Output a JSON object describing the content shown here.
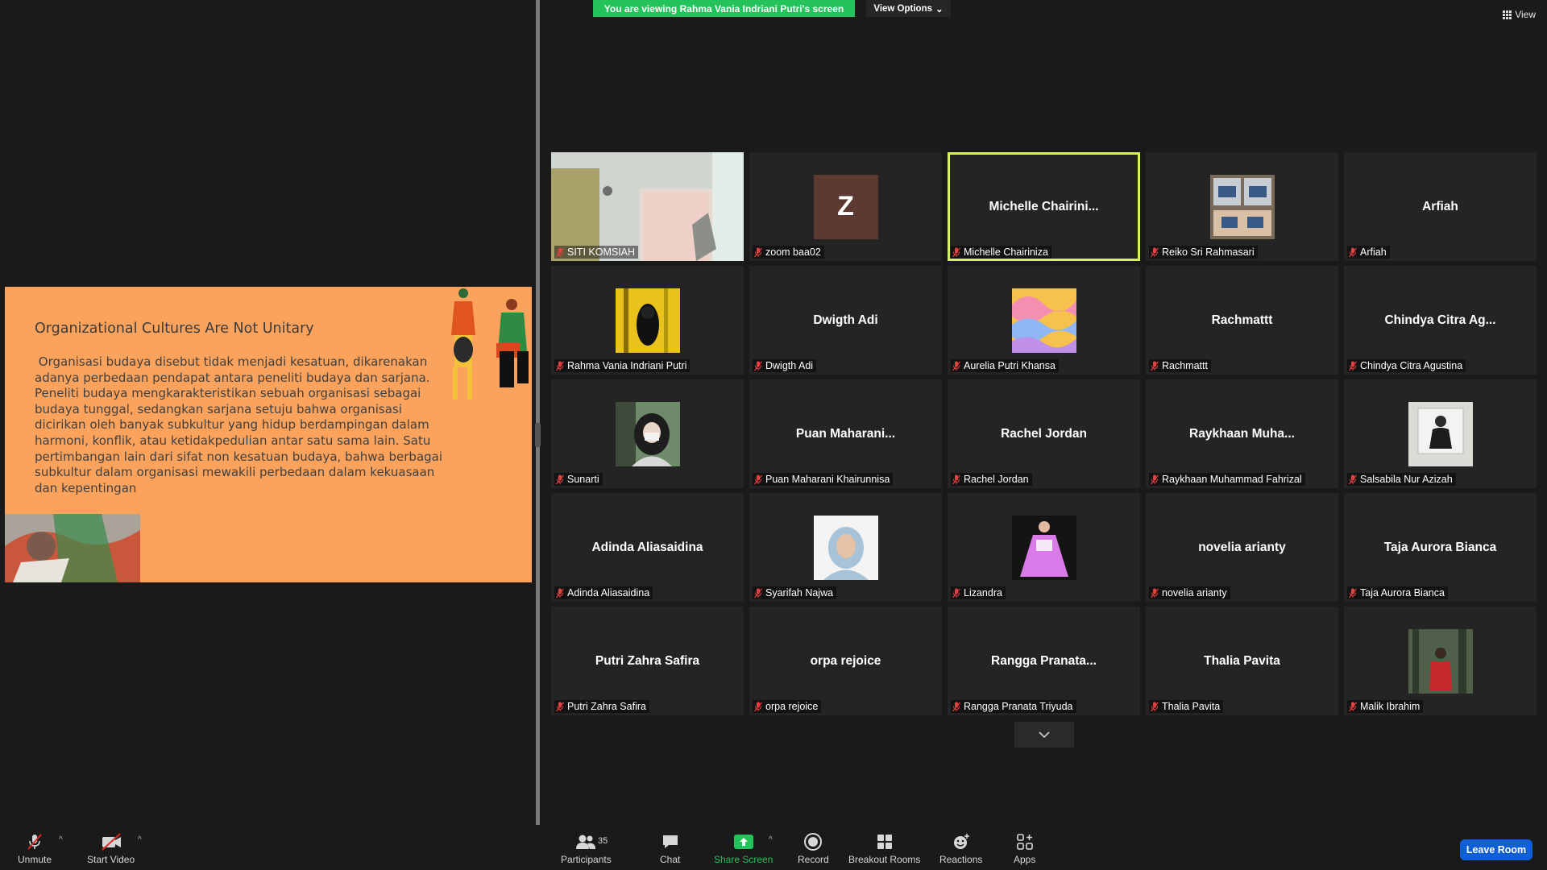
{
  "banner": {
    "viewing_text": "You are viewing Rahma Vania Indriani Putri's screen",
    "view_options_label": "View Options",
    "view_label": "View"
  },
  "slide": {
    "title": "Organizational Cultures Are Not Unitary",
    "body": " Organisasi budaya disebut tidak menjadi kesatuan, dikarenakan\nadanya perbedaan pendapat antara peneliti budaya dan sarjana.\nPeneliti budaya mengkarakteristikan sebuah organisasi sebagai\nbudaya tunggal, sedangkan sarjana setuju bahwa organisasi\ndicirikan oleh banyak subkultur yang hidup berdampingan dalam\nharmoni, konflik, atau ketidakpedulian antar satu sama lain. Satu\npertimbangan lain dari sifat non kesatuan budaya, bahwa berbagai\nsubkultur dalam organisasi mewakili perbedaan dalam kekuasaan\ndan kepentingan"
  },
  "participants": [
    {
      "label": "SITI KOMSIAH",
      "center": "",
      "kind": "video-room"
    },
    {
      "label": "zoom baa02",
      "center": "Z",
      "kind": "letter"
    },
    {
      "label": "Michelle Chairiniza",
      "center": "Michelle  Chairini...",
      "kind": "name",
      "active": true
    },
    {
      "label": "Reiko Sri Rahmasari",
      "center": "",
      "kind": "avatar-desk"
    },
    {
      "label": "Arfiah",
      "center": "Arfiah",
      "kind": "name"
    },
    {
      "label": "Rahma Vania Indriani Putri",
      "center": "",
      "kind": "avatar-yellow"
    },
    {
      "label": "Dwigth Adi",
      "center": "Dwigth Adi",
      "kind": "name"
    },
    {
      "label": "Aurelia Putri Khansa",
      "center": "",
      "kind": "avatar-waves"
    },
    {
      "label": "Rachmattt",
      "center": "Rachmattt",
      "kind": "name"
    },
    {
      "label": "Chindya Citra Agustina",
      "center": "Chindya Citra Ag...",
      "kind": "name"
    },
    {
      "label": "Sunarti",
      "center": "",
      "kind": "avatar-selfie"
    },
    {
      "label": "Puan Maharani Khairunnisa",
      "center": "Puan  Maharani...",
      "kind": "name"
    },
    {
      "label": "Rachel Jordan",
      "center": "Rachel Jordan",
      "kind": "name"
    },
    {
      "label": "Raykhaan Muhammad Fahrizal",
      "center": "Raykhaan  Muha...",
      "kind": "name"
    },
    {
      "label": "Salsabila Nur Azizah",
      "center": "",
      "kind": "avatar-polaroid"
    },
    {
      "label": "Adinda Aliasaidina",
      "center": "Adinda Aliasaidina",
      "kind": "name"
    },
    {
      "label": "Syarifah Najwa",
      "center": "",
      "kind": "avatar-hijab"
    },
    {
      "label": "Lizandra",
      "center": "",
      "kind": "avatar-dress"
    },
    {
      "label": "novelia arianty",
      "center": "novelia arianty",
      "kind": "name"
    },
    {
      "label": "Taja Aurora Bianca",
      "center": "Taja Aurora Bianca",
      "kind": "name"
    },
    {
      "label": "Putri Zahra Safira",
      "center": "Putri Zahra Safira",
      "kind": "name"
    },
    {
      "label": "orpa rejoice",
      "center": "orpa rejoice",
      "kind": "name"
    },
    {
      "label": "Rangga Pranata Triyuda",
      "center": "Rangga  Pranata...",
      "kind": "name"
    },
    {
      "label": "Thalia Pavita",
      "center": "Thalia Pavita",
      "kind": "name"
    },
    {
      "label": "Malik Ibrahim",
      "center": "",
      "kind": "avatar-forest"
    }
  ],
  "toolbar": {
    "unmute": "Unmute",
    "start_video": "Start Video",
    "participants": "Participants",
    "participants_count": "35",
    "chat": "Chat",
    "share_screen": "Share Screen",
    "record": "Record",
    "breakout_rooms": "Breakout Rooms",
    "reactions": "Reactions",
    "apps": "Apps",
    "leave": "Leave Room"
  },
  "colors": {
    "banner_green": "#23c25a",
    "active_speaker": "#d6f25d",
    "leave_blue": "#0e5fd8",
    "slide_bg": "#fba35d"
  }
}
